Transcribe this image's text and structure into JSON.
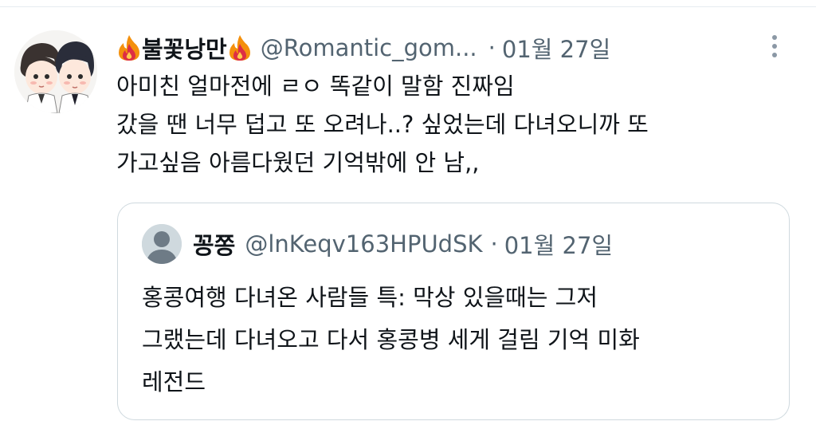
{
  "tweet": {
    "display_name": "불꽃낭만",
    "handle": "@Romantic_gom...",
    "separator": "·",
    "time": "01월 27일",
    "text_lines": [
      "아미친 얼마전에 ㄹㅇ 똑같이 말함 진짜임",
      "갔을 땐 너무 덥고 또 오려나..? 싶었는데 다녀오니까 또",
      "가고싶음 아름다웠던 기억밖에 안 남,,"
    ]
  },
  "quoted_tweet": {
    "display_name": "꽁쫑",
    "handle": "@lnKeqv163HPUdSK",
    "separator": "·",
    "time": "01월 27일",
    "text_lines": [
      "홍콩여행 다녀온 사람들 특: 막상 있을때는 그저",
      "그랬는데 다녀오고 다서 홍콩병 세게 걸림 기억 미화",
      "레전드"
    ]
  },
  "icons": {
    "name_emoji": "fire-icon",
    "more": "more-options-icon",
    "quoted_avatar": "default-avatar-icon"
  },
  "colors": {
    "text_primary": "#0f1419",
    "text_secondary": "#536471",
    "border": "#cfd9de",
    "fire_orange": "#f4900c",
    "fire_red": "#dd2e44"
  }
}
